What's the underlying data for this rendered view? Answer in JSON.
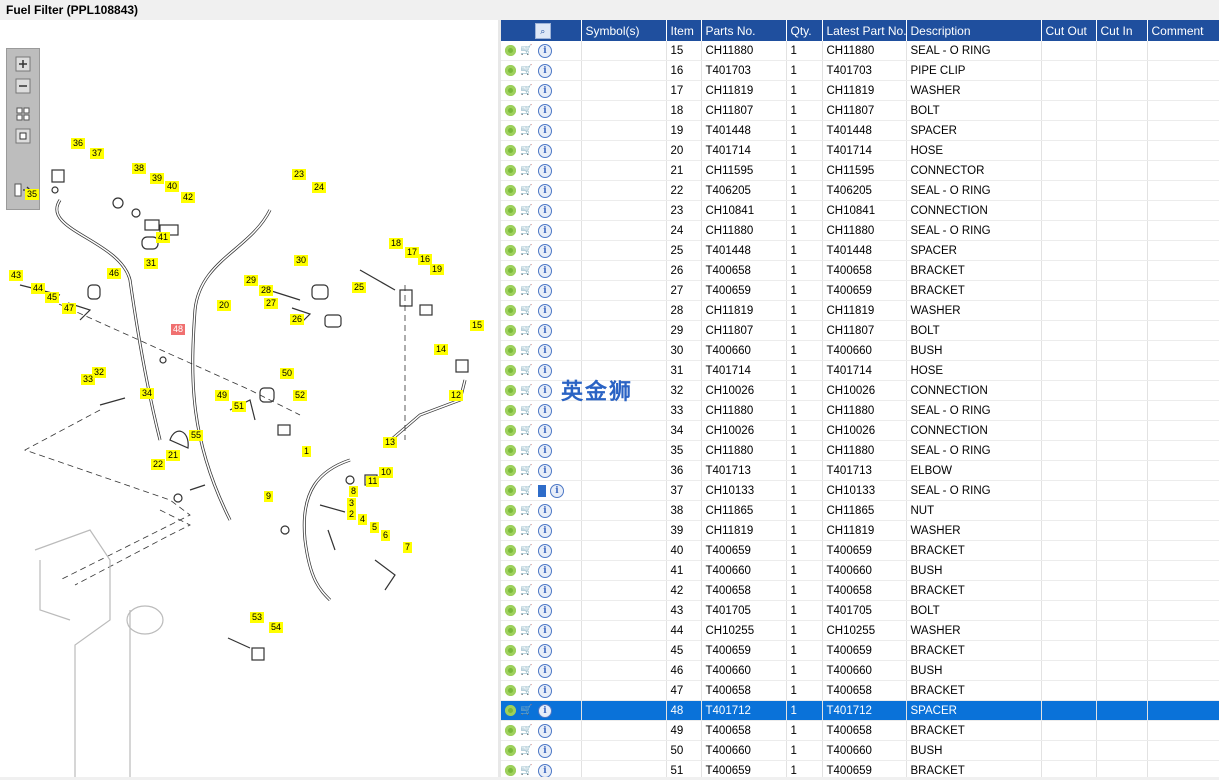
{
  "window": {
    "title": "Fuel Filter (PPL108843)"
  },
  "watermark": "英金狮",
  "colors": {
    "header_bg": "#1f4f9e",
    "selected_row": "#0a72d9",
    "callout": "#ffff00",
    "callout_selected": "#f07070"
  },
  "toolbox": {
    "buttons": [
      {
        "name": "zoom-in-icon",
        "glyph": "+"
      },
      {
        "name": "zoom-out-icon",
        "glyph": "−"
      },
      {
        "name": "fit-page-icon",
        "glyph": "▦"
      },
      {
        "name": "actual-size-icon",
        "glyph": "□"
      },
      {
        "name": "toggle-list-icon",
        "glyph": "⇶"
      }
    ]
  },
  "diagram": {
    "callouts": [
      "1",
      "2",
      "3",
      "4",
      "5",
      "6",
      "7",
      "8",
      "9",
      "10",
      "11",
      "12",
      "13",
      "14",
      "15",
      "16",
      "17",
      "18",
      "19",
      "20",
      "21",
      "22",
      "23",
      "24",
      "25",
      "26",
      "27",
      "28",
      "29",
      "30",
      "31",
      "32",
      "33",
      "34",
      "35",
      "36",
      "37",
      "38",
      "39",
      "40",
      "41",
      "42",
      "43",
      "44",
      "45",
      "46",
      "47",
      "48",
      "49",
      "50",
      "51",
      "52",
      "53",
      "54",
      "55"
    ],
    "selected_callout": "48"
  },
  "table": {
    "headers": {
      "tool": "🔍",
      "symbols": "Symbol(s)",
      "item": "Item",
      "parts_no": "Parts No.",
      "qty": "Qty.",
      "latest": "Latest Part No.",
      "description": "Description",
      "cut_out": "Cut Out",
      "cut_in": "Cut In",
      "comment": "Comment"
    },
    "rows": [
      {
        "item": "15",
        "parts_no": "CH11880",
        "qty": "1",
        "latest": "CH11880",
        "description": "SEAL - O RING"
      },
      {
        "item": "16",
        "parts_no": "T401703",
        "qty": "1",
        "latest": "T401703",
        "description": "PIPE CLIP"
      },
      {
        "item": "17",
        "parts_no": "CH11819",
        "qty": "1",
        "latest": "CH11819",
        "description": "WASHER"
      },
      {
        "item": "18",
        "parts_no": "CH11807",
        "qty": "1",
        "latest": "CH11807",
        "description": "BOLT"
      },
      {
        "item": "19",
        "parts_no": "T401448",
        "qty": "1",
        "latest": "T401448",
        "description": "SPACER"
      },
      {
        "item": "20",
        "parts_no": "T401714",
        "qty": "1",
        "latest": "T401714",
        "description": "HOSE"
      },
      {
        "item": "21",
        "parts_no": "CH11595",
        "qty": "1",
        "latest": "CH11595",
        "description": "CONNECTOR"
      },
      {
        "item": "22",
        "parts_no": "T406205",
        "qty": "1",
        "latest": "T406205",
        "description": "SEAL - O RING"
      },
      {
        "item": "23",
        "parts_no": "CH10841",
        "qty": "1",
        "latest": "CH10841",
        "description": "CONNECTION"
      },
      {
        "item": "24",
        "parts_no": "CH11880",
        "qty": "1",
        "latest": "CH11880",
        "description": "SEAL - O RING"
      },
      {
        "item": "25",
        "parts_no": "T401448",
        "qty": "1",
        "latest": "T401448",
        "description": "SPACER"
      },
      {
        "item": "26",
        "parts_no": "T400658",
        "qty": "1",
        "latest": "T400658",
        "description": "BRACKET"
      },
      {
        "item": "27",
        "parts_no": "T400659",
        "qty": "1",
        "latest": "T400659",
        "description": "BRACKET"
      },
      {
        "item": "28",
        "parts_no": "CH11819",
        "qty": "1",
        "latest": "CH11819",
        "description": "WASHER"
      },
      {
        "item": "29",
        "parts_no": "CH11807",
        "qty": "1",
        "latest": "CH11807",
        "description": "BOLT"
      },
      {
        "item": "30",
        "parts_no": "T400660",
        "qty": "1",
        "latest": "T400660",
        "description": "BUSH"
      },
      {
        "item": "31",
        "parts_no": "T401714",
        "qty": "1",
        "latest": "T401714",
        "description": "HOSE"
      },
      {
        "item": "32",
        "parts_no": "CH10026",
        "qty": "1",
        "latest": "CH10026",
        "description": "CONNECTION"
      },
      {
        "item": "33",
        "parts_no": "CH11880",
        "qty": "1",
        "latest": "CH11880",
        "description": "SEAL - O RING"
      },
      {
        "item": "34",
        "parts_no": "CH10026",
        "qty": "1",
        "latest": "CH10026",
        "description": "CONNECTION"
      },
      {
        "item": "35",
        "parts_no": "CH11880",
        "qty": "1",
        "latest": "CH11880",
        "description": "SEAL - O RING"
      },
      {
        "item": "36",
        "parts_no": "T401713",
        "qty": "1",
        "latest": "T401713",
        "description": "ELBOW"
      },
      {
        "item": "37",
        "parts_no": "CH10133",
        "qty": "1",
        "latest": "CH10133",
        "description": "SEAL - O RING",
        "book": true
      },
      {
        "item": "38",
        "parts_no": "CH11865",
        "qty": "1",
        "latest": "CH11865",
        "description": "NUT"
      },
      {
        "item": "39",
        "parts_no": "CH11819",
        "qty": "1",
        "latest": "CH11819",
        "description": "WASHER"
      },
      {
        "item": "40",
        "parts_no": "T400659",
        "qty": "1",
        "latest": "T400659",
        "description": "BRACKET"
      },
      {
        "item": "41",
        "parts_no": "T400660",
        "qty": "1",
        "latest": "T400660",
        "description": "BUSH"
      },
      {
        "item": "42",
        "parts_no": "T400658",
        "qty": "1",
        "latest": "T400658",
        "description": "BRACKET"
      },
      {
        "item": "43",
        "parts_no": "T401705",
        "qty": "1",
        "latest": "T401705",
        "description": "BOLT"
      },
      {
        "item": "44",
        "parts_no": "CH10255",
        "qty": "1",
        "latest": "CH10255",
        "description": "WASHER"
      },
      {
        "item": "45",
        "parts_no": "T400659",
        "qty": "1",
        "latest": "T400659",
        "description": "BRACKET"
      },
      {
        "item": "46",
        "parts_no": "T400660",
        "qty": "1",
        "latest": "T400660",
        "description": "BUSH"
      },
      {
        "item": "47",
        "parts_no": "T400658",
        "qty": "1",
        "latest": "T400658",
        "description": "BRACKET"
      },
      {
        "item": "48",
        "parts_no": "T401712",
        "qty": "1",
        "latest": "T401712",
        "description": "SPACER",
        "selected": true
      },
      {
        "item": "49",
        "parts_no": "T400658",
        "qty": "1",
        "latest": "T400658",
        "description": "BRACKET"
      },
      {
        "item": "50",
        "parts_no": "T400660",
        "qty": "1",
        "latest": "T400660",
        "description": "BUSH"
      },
      {
        "item": "51",
        "parts_no": "T400659",
        "qty": "1",
        "latest": "T400659",
        "description": "BRACKET"
      }
    ]
  }
}
